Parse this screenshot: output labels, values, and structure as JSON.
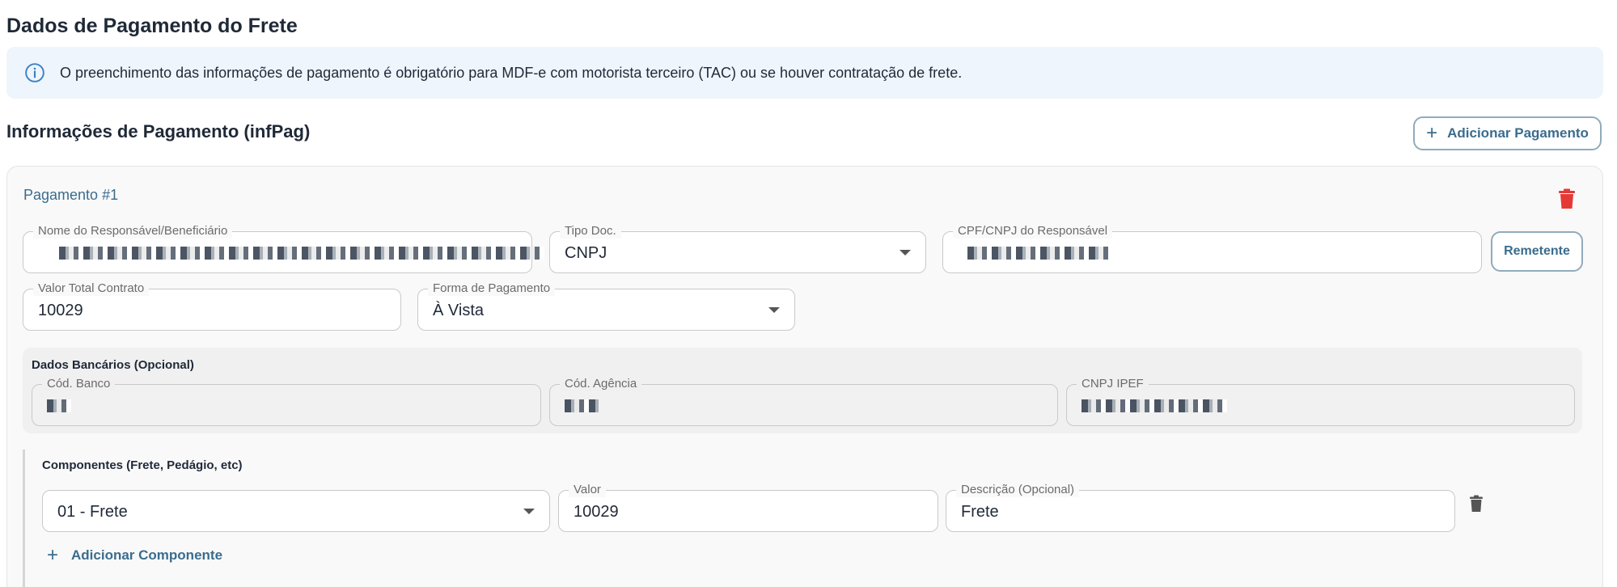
{
  "header": {
    "title": "Dados de Pagamento do Frete",
    "info_text": "O preenchimento das informações de pagamento é obrigatório para MDF-e com motorista terceiro (TAC) ou se houver contratação de frete."
  },
  "payment_section": {
    "title": "Informações de Pagamento (infPag)",
    "add_button_label": "Adicionar Pagamento"
  },
  "payment": {
    "label": "Pagamento #1",
    "responsible_name": {
      "label": "Nome do Responsável/Beneficiário",
      "value": ""
    },
    "doc_type": {
      "label": "Tipo Doc.",
      "value": "CNPJ"
    },
    "doc_number": {
      "label": "CPF/CNPJ do Responsável",
      "value": ""
    },
    "remetente_button": "Remetente",
    "contract_total": {
      "label": "Valor Total Contrato",
      "value": "10029"
    },
    "payment_method": {
      "label": "Forma de Pagamento",
      "value": "À Vista"
    }
  },
  "bank": {
    "title": "Dados Bancários (Opcional)",
    "bank_code": {
      "label": "Cód. Banco",
      "value": ""
    },
    "agency_code": {
      "label": "Cód. Agência",
      "value": ""
    },
    "ipef_cnpj": {
      "label": "CNPJ IPEF",
      "value": ""
    }
  },
  "components": {
    "title": "Componentes (Frete, Pedágio, etc)",
    "type": {
      "value": "01 - Frete"
    },
    "amount": {
      "label": "Valor",
      "value": "10029"
    },
    "description": {
      "label": "Descrição (Opcional)",
      "value": "Frete"
    },
    "add_label": "Adicionar Componente"
  },
  "colors": {
    "accent": "#3b6c8e",
    "danger": "#e53935",
    "info_bg": "#eef5fc"
  }
}
